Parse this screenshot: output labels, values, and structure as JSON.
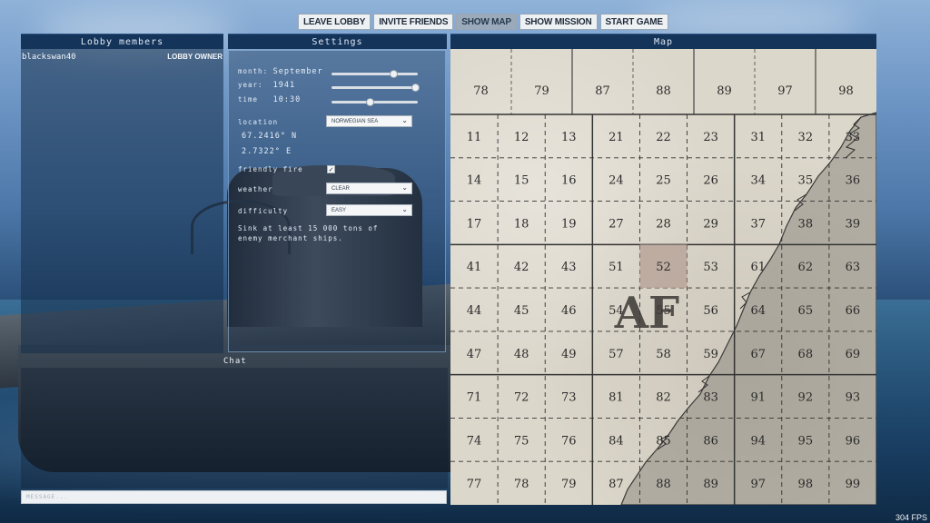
{
  "topbar": {
    "buttons": [
      {
        "label": "LEAVE LOBBY",
        "active": false
      },
      {
        "label": "INVITE FRIENDS",
        "active": false
      },
      {
        "label": "SHOW MAP",
        "active": true
      },
      {
        "label": "SHOW MISSION",
        "active": false
      },
      {
        "label": "START GAME",
        "active": false
      }
    ]
  },
  "panels": {
    "lobby_title": "Lobby members",
    "settings_title": "Settings",
    "map_title": "Map"
  },
  "lobby": {
    "member_name": "blackswan40",
    "member_role": "LOBBY OWNER"
  },
  "settings": {
    "month_label": "month:",
    "month_value": "September",
    "month_slider": 0.72,
    "year_label": "year:",
    "year_value": "1941",
    "year_slider": 0.97,
    "time_label": "time",
    "time_value": "10:30",
    "time_slider": 0.45,
    "location_label": "location",
    "location_value": "NORWEGIAN SEA",
    "lat": "67.2416° N",
    "lon": "2.7322° E",
    "friendly_fire_label": "friendly fire",
    "friendly_fire_checked": true,
    "check_mark": "✓",
    "weather_label": "weather",
    "weather_value": "CLEAR",
    "difficulty_label": "difficulty",
    "difficulty_value": "EASY",
    "mission_line1": "Sink at least 15 000 tons of",
    "mission_line2": "enemy merchant ships."
  },
  "chat": {
    "title": "Chat",
    "placeholder": "MESSAGE..."
  },
  "map": {
    "top_row": [
      "78",
      "79",
      "87",
      "88",
      "89",
      "97",
      "98"
    ],
    "grid": [
      [
        "11",
        "12",
        "13",
        "21",
        "22",
        "23",
        "31",
        "32",
        "33"
      ],
      [
        "14",
        "15",
        "16",
        "24",
        "25",
        "26",
        "34",
        "35",
        "36"
      ],
      [
        "17",
        "18",
        "19",
        "27",
        "28",
        "29",
        "37",
        "38",
        "39"
      ],
      [
        "41",
        "42",
        "43",
        "51",
        "52",
        "53",
        "61",
        "62",
        "63"
      ],
      [
        "44",
        "45",
        "46",
        "54",
        "55",
        "56",
        "64",
        "65",
        "66"
      ],
      [
        "47",
        "48",
        "49",
        "57",
        "58",
        "59",
        "67",
        "68",
        "69"
      ],
      [
        "71",
        "72",
        "73",
        "81",
        "82",
        "83",
        "91",
        "92",
        "93"
      ],
      [
        "74",
        "75",
        "76",
        "84",
        "85",
        "86",
        "94",
        "95",
        "96"
      ],
      [
        "77",
        "78",
        "79",
        "87",
        "88",
        "89",
        "97",
        "98",
        "99"
      ]
    ],
    "big_label": "AF",
    "highlight": "52",
    "highlight_color": "#b8a49a"
  },
  "fps": "304 FPS",
  "icons": {
    "chevron": "⌄"
  }
}
